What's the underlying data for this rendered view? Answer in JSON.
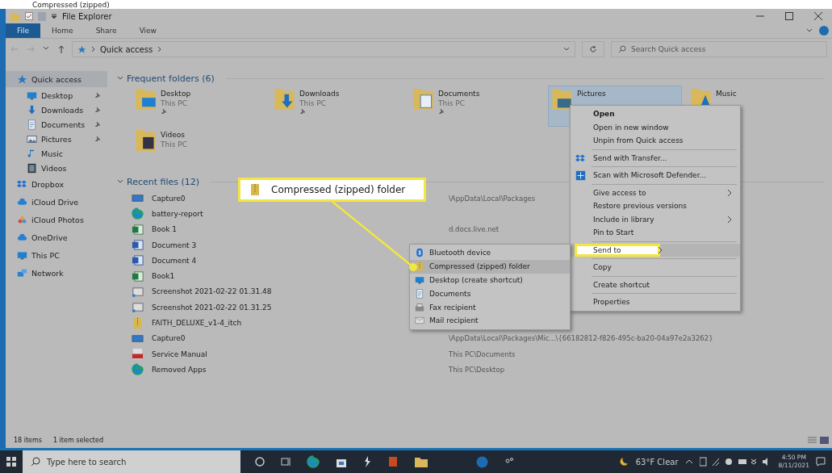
{
  "caption": "Compressed (zipped)",
  "window": {
    "title": "File Explorer"
  },
  "ribbon_tabs": [
    {
      "label": "File",
      "selected": true
    },
    {
      "label": "Home",
      "selected": false
    },
    {
      "label": "Share",
      "selected": false
    },
    {
      "label": "View",
      "selected": false
    }
  ],
  "address": {
    "path": "Quick access"
  },
  "search": {
    "placeholder": "Search Quick access"
  },
  "sidebar": {
    "items": [
      {
        "label": "Quick access",
        "kind": "star",
        "selected": true,
        "children": [
          {
            "label": "Desktop",
            "kind": "desktop",
            "pinned": true
          },
          {
            "label": "Downloads",
            "kind": "download",
            "pinned": true
          },
          {
            "label": "Documents",
            "kind": "document",
            "pinned": true
          },
          {
            "label": "Pictures",
            "kind": "picture",
            "pinned": true
          },
          {
            "label": "Music",
            "kind": "music",
            "pinned": false
          },
          {
            "label": "Videos",
            "kind": "video",
            "pinned": false
          }
        ]
      },
      {
        "label": "Dropbox",
        "kind": "dropbox",
        "selected": false
      },
      {
        "label": "iCloud Drive",
        "kind": "cloud",
        "selected": false
      },
      {
        "label": "iCloud Photos",
        "kind": "photos",
        "selected": false
      },
      {
        "label": "OneDrive",
        "kind": "cloud",
        "selected": false
      },
      {
        "label": "This PC",
        "kind": "desktop",
        "selected": false
      },
      {
        "label": "Network",
        "kind": "network",
        "selected": false
      }
    ]
  },
  "frequent": {
    "title": "Frequent folders (6)",
    "expanded": true,
    "folders": [
      {
        "name": "Desktop",
        "location": "This PC",
        "pinned": true,
        "selected": false,
        "kind": "desktop"
      },
      {
        "name": "Downloads",
        "location": "This PC",
        "pinned": true,
        "selected": false,
        "kind": "download"
      },
      {
        "name": "Documents",
        "location": "This PC",
        "pinned": true,
        "selected": false,
        "kind": "document"
      },
      {
        "name": "Pictures",
        "pinned": false,
        "selected": true,
        "kind": "picture"
      },
      {
        "name": "Music",
        "pinned": false,
        "selected": false,
        "kind": "music"
      },
      {
        "name": "Videos",
        "location": "This PC",
        "pinned": false,
        "selected": false,
        "kind": "video"
      }
    ]
  },
  "recent": {
    "title": "Recent files (12)",
    "expanded": true,
    "files": [
      {
        "name": "Capture0",
        "location": "\\AppData\\Local\\Packages",
        "kind": "image"
      },
      {
        "name": "battery-report",
        "kind": "edge"
      },
      {
        "name": "Book 1",
        "location": "d.docs.live.net",
        "kind": "excel"
      },
      {
        "name": "Document 3",
        "kind": "word"
      },
      {
        "name": "Document 4",
        "kind": "word"
      },
      {
        "name": "Book1",
        "kind": "excel"
      },
      {
        "name": "Screenshot 2021-02-22 01.31.48",
        "kind": "screenshot"
      },
      {
        "name": "Screenshot 2021-02-22 01.31.25",
        "kind": "screenshot"
      },
      {
        "name": "FAITH_DELUXE_v1-4_itch",
        "kind": "zip"
      },
      {
        "name": "Capture0",
        "location": "\\AppData\\Local\\Packages\\Mic...\\{66182812-f826-495c-ba20-04a97e2a3262}",
        "kind": "image"
      },
      {
        "name": "Service Manual",
        "location": "This PC\\Documents",
        "kind": "pdf"
      },
      {
        "name": "Removed Apps",
        "location": "This PC\\Desktop",
        "kind": "edge"
      }
    ]
  },
  "context_menu": {
    "groups": [
      [
        {
          "label": "Open",
          "bold": true,
          "submenu": false,
          "highlighted": false
        },
        {
          "label": "Open in new window",
          "bold": false,
          "submenu": false,
          "highlighted": false
        },
        {
          "label": "Unpin from Quick access",
          "bold": false,
          "submenu": false,
          "highlighted": false
        }
      ],
      [
        {
          "label": "Send with Transfer...",
          "kind": "dropbox",
          "bold": false,
          "submenu": false,
          "highlighted": false
        }
      ],
      [
        {
          "label": "Scan with Microsoft Defender...",
          "kind": "shield",
          "bold": false,
          "submenu": false,
          "highlighted": false
        }
      ],
      [
        {
          "label": "Give access to",
          "bold": false,
          "submenu": true,
          "highlighted": false
        },
        {
          "label": "Restore previous versions",
          "bold": false,
          "submenu": false,
          "highlighted": false
        },
        {
          "label": "Include in library",
          "bold": false,
          "submenu": true,
          "highlighted": false
        },
        {
          "label": "Pin to Start",
          "bold": false,
          "submenu": false,
          "highlighted": false
        }
      ],
      [
        {
          "label": "Send to",
          "bold": false,
          "submenu": true,
          "highlighted": true
        }
      ],
      [
        {
          "label": "Copy",
          "bold": false,
          "submenu": false,
          "highlighted": false
        }
      ],
      [
        {
          "label": "Create shortcut",
          "bold": false,
          "submenu": false,
          "highlighted": false
        }
      ],
      [
        {
          "label": "Properties",
          "bold": false,
          "submenu": false,
          "highlighted": false
        }
      ]
    ]
  },
  "send_to_menu": {
    "items": [
      {
        "label": "Bluetooth device",
        "kind": "bluetooth",
        "selected": false
      },
      {
        "label": "Compressed (zipped) folder",
        "kind": "zip",
        "selected": true
      },
      {
        "label": "Desktop (create shortcut)",
        "kind": "desktop",
        "selected": false
      },
      {
        "label": "Documents",
        "kind": "document",
        "selected": false
      },
      {
        "label": "Fax recipient",
        "kind": "fax",
        "selected": false
      },
      {
        "label": "Mail recipient",
        "kind": "mail",
        "selected": false
      }
    ]
  },
  "callout": {
    "label": "Compressed (zipped) folder"
  },
  "status_bar": {
    "item_count": "18 items",
    "selection": "1 item selected"
  },
  "taskbar": {
    "search_placeholder": "Type here to search",
    "weather": "63°F Clear",
    "time": "4:50 PM",
    "date": "8/11/2021"
  }
}
